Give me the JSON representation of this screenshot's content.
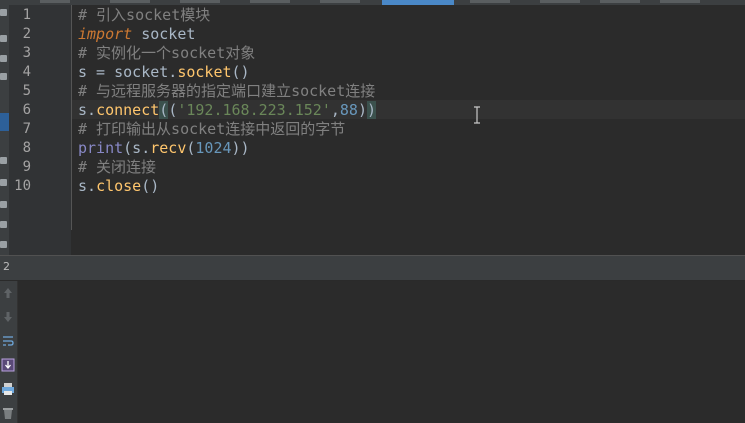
{
  "editor": {
    "line_numbers": [
      "1",
      "2",
      "3",
      "4",
      "5",
      "6",
      "7",
      "8",
      "9",
      "10"
    ],
    "lines": [
      {
        "comment": "# 引入socket模块"
      },
      {
        "kw": "import",
        "rest": " socket"
      },
      {
        "comment": "# 实例化一个socket对象"
      },
      {
        "lhs": "s = socket.",
        "call": "socket",
        "args": "()"
      },
      {
        "comment": "# 与远程服务器的指定端口建立socket连接"
      },
      {
        "obj": "s.",
        "call": "connect",
        "open_paren": "(",
        "tuple_open": "(",
        "str": "'192.168.223.152'",
        "comma": ",",
        "num": "88",
        "tuple_close": ")",
        "close_paren": ")"
      },
      {
        "comment": "# 打印输出从socket连接中返回的字节"
      },
      {
        "builtin": "print",
        "open": "(s.",
        "call": "recv",
        "paren": "(",
        "num": "1024",
        "close": "))"
      },
      {
        "comment": "# 关闭连接"
      },
      {
        "obj": "s.",
        "call": "close",
        "args": "()"
      }
    ]
  },
  "run_panel": {
    "label": "2"
  },
  "icons": {
    "left_strip": [
      "bookmark-icon",
      "bookmark-icon",
      "structure-icon",
      "favorites-icon",
      "bookmark-icon",
      "bookmark-icon",
      "bookmark-icon",
      "bookmark-icon",
      "bookmark-icon",
      "bookmark-icon"
    ],
    "console_toolbar": [
      "arrow-up-icon",
      "arrow-down-icon",
      "soft-wrap-icon",
      "scroll-to-end-icon",
      "print-icon",
      "trash-icon"
    ]
  },
  "colors": {
    "background": "#2b2b2b",
    "comment": "#808080",
    "keyword": "#cc7832",
    "function": "#ffc66d",
    "builtin": "#8888c6",
    "string": "#6a8759",
    "number": "#6897bb",
    "selection_tab": "#4a88c7"
  }
}
